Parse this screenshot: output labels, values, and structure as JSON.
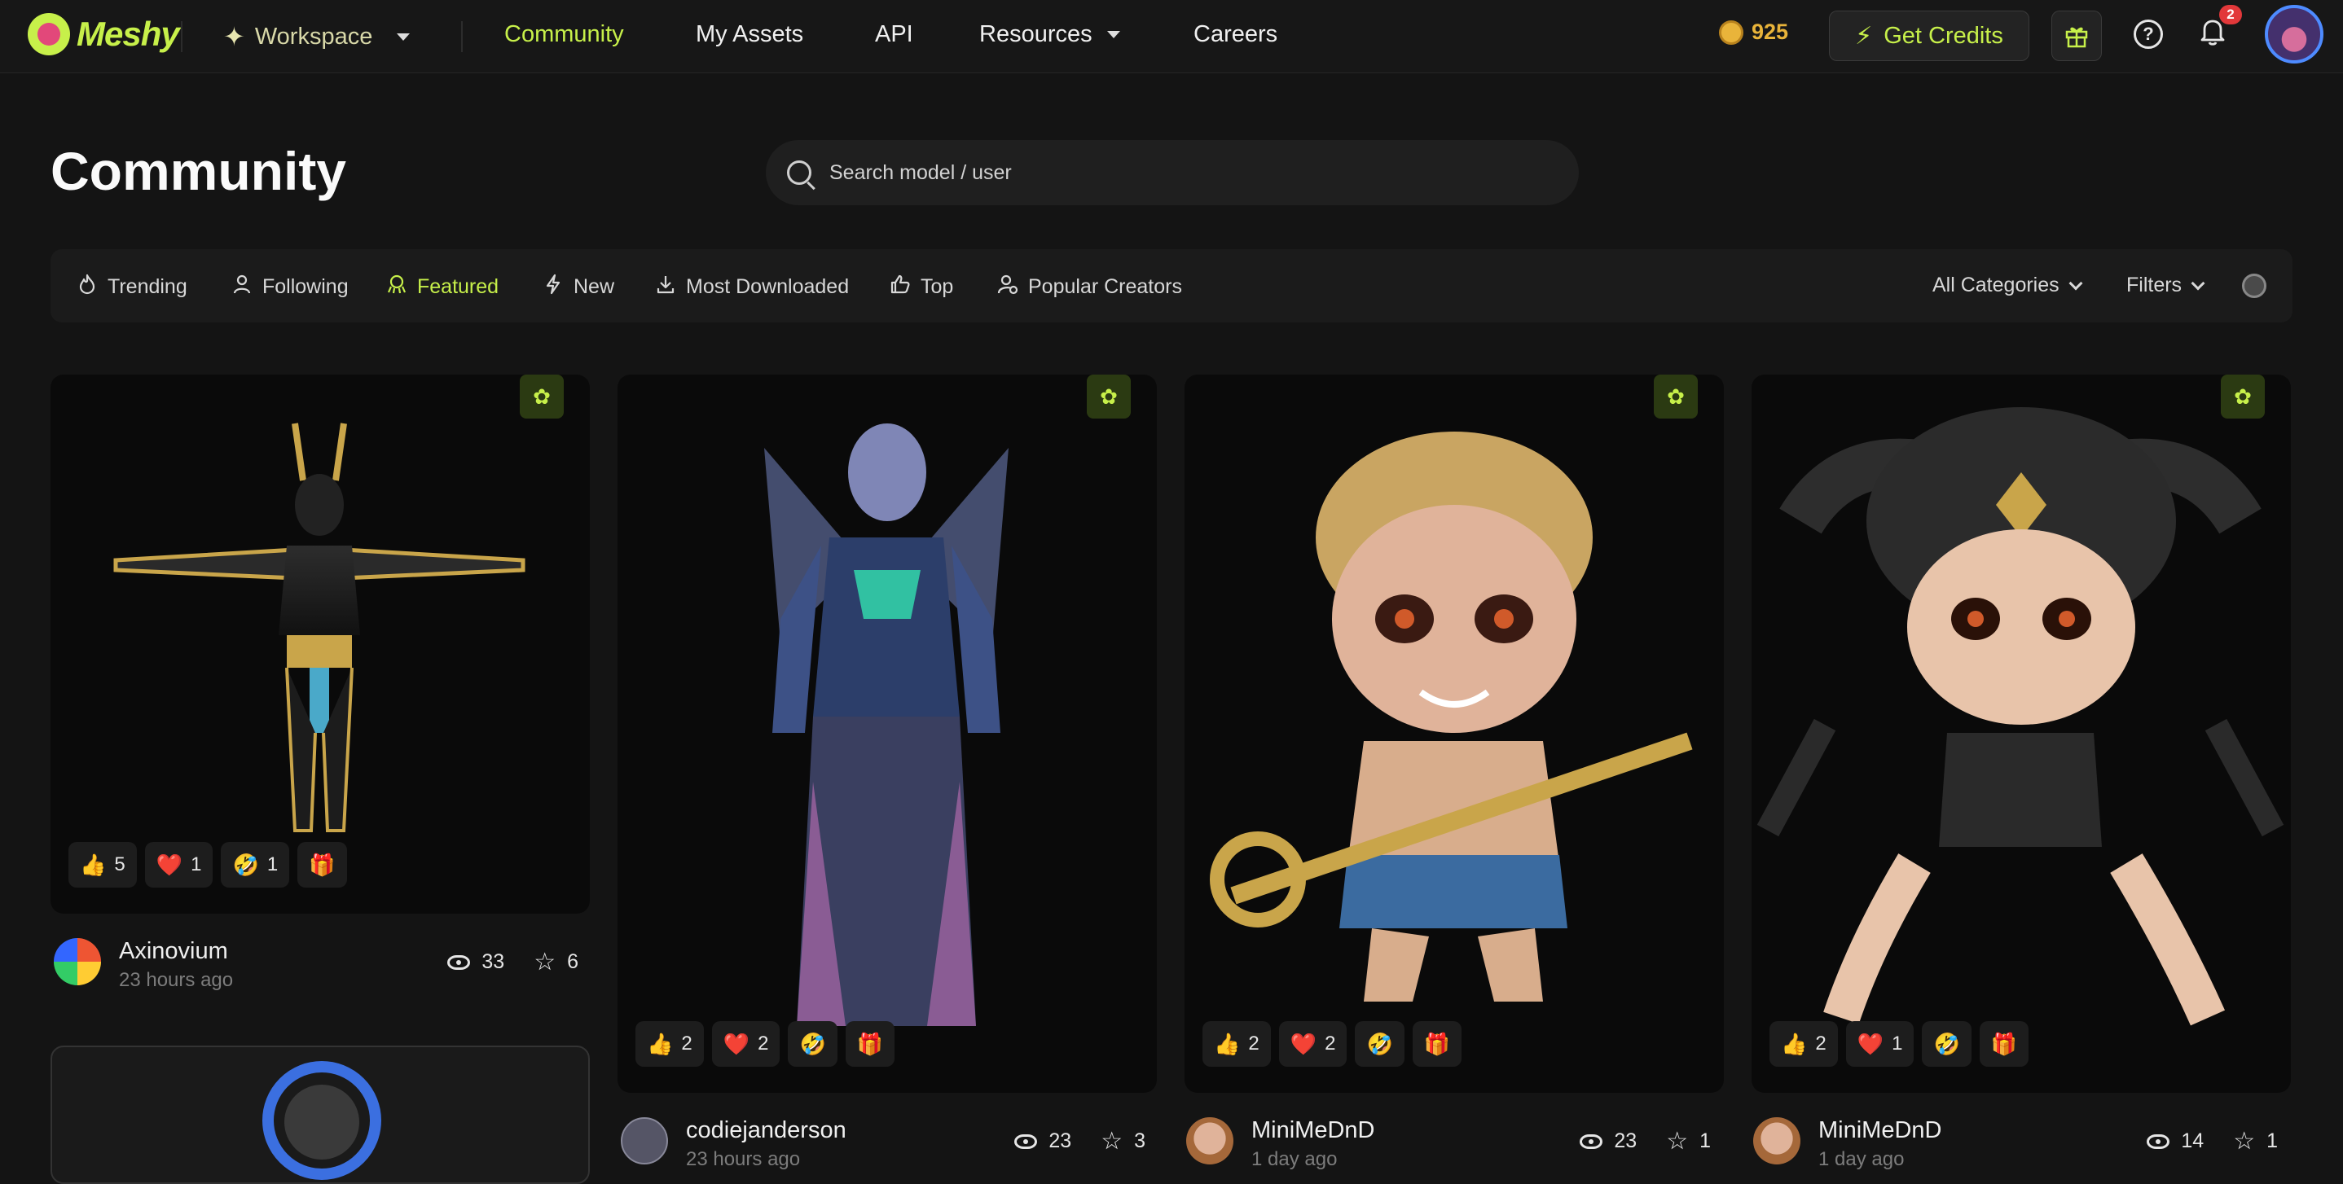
{
  "nav": {
    "logo": "Meshy",
    "workspace": "Workspace",
    "community": "Community",
    "my_assets": "My Assets",
    "api": "API",
    "resources": "Resources",
    "careers": "Careers",
    "credits": "925",
    "get_credits": "Get Credits",
    "notifications_count": "2"
  },
  "page": {
    "title": "Community",
    "search_placeholder": "Search model / user"
  },
  "tabs": [
    {
      "label": "Trending",
      "icon": "flame-icon"
    },
    {
      "label": "Following",
      "icon": "user-icon"
    },
    {
      "label": "Featured",
      "icon": "featured-icon",
      "active": true
    },
    {
      "label": "New",
      "icon": "bolt-icon"
    },
    {
      "label": "Most Downloaded",
      "icon": "download-icon"
    },
    {
      "label": "Top",
      "icon": "thumbs-up-icon"
    },
    {
      "label": "Popular Creators",
      "icon": "creator-icon"
    }
  ],
  "filters": {
    "categories": "All Categories",
    "filters": "Filters"
  },
  "accent": "#c7f04a",
  "cards": [
    {
      "creator": "Axinovium",
      "time": "23 hours ago",
      "views": "33",
      "stars": "6",
      "reactions": {
        "like": "5",
        "heart": "1",
        "laugh": "1"
      }
    },
    {
      "creator": "codiejanderson",
      "time": "23 hours ago",
      "views": "23",
      "stars": "3",
      "reactions": {
        "like": "2",
        "heart": "2",
        "laugh": ""
      }
    },
    {
      "creator": "MiniMeDnD",
      "time": "1 day ago",
      "views": "23",
      "stars": "1",
      "reactions": {
        "like": "2",
        "heart": "2",
        "laugh": ""
      }
    },
    {
      "creator": "MiniMeDnD",
      "time": "1 day ago",
      "views": "14",
      "stars": "1",
      "reactions": {
        "like": "2",
        "heart": "1",
        "laugh": ""
      }
    }
  ]
}
